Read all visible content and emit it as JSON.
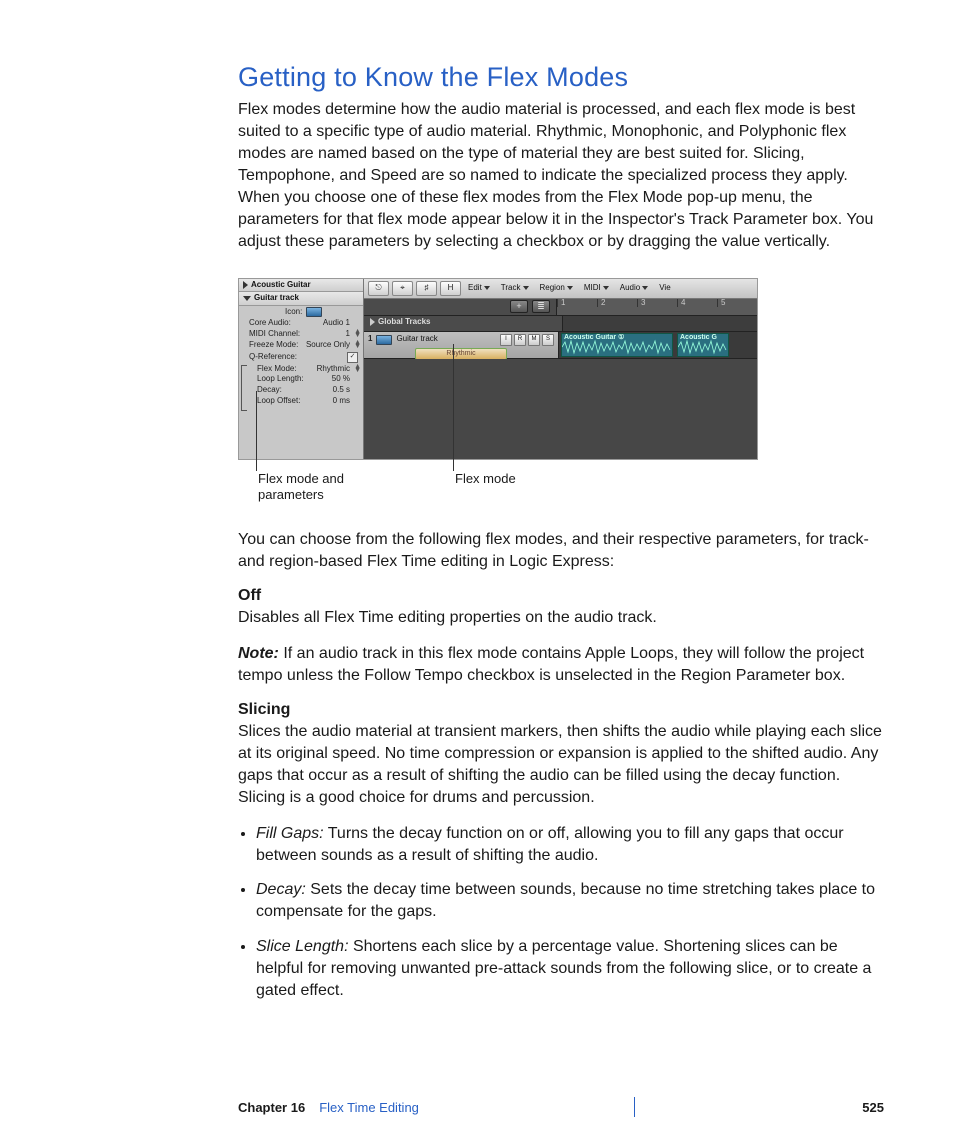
{
  "heading": "Getting to Know the Flex Modes",
  "intro": "Flex modes determine how the audio material is processed, and each flex mode is best suited to a specific type of audio material. Rhythmic, Monophonic, and Polyphonic flex modes are named based on the type of material they are best suited for. Slicing, Tempophone, and Speed are so named to indicate the specialized process they apply. When you choose one of these flex modes from the Flex Mode pop-up menu, the parameters for that flex mode appear below it in the Inspector's Track Parameter box. You adjust these parameters by selecting a checkbox or by dragging the value vertically.",
  "figure": {
    "inspector": {
      "header1": "Acoustic Guitar",
      "header2": "Guitar track",
      "rows": {
        "iconLabel": "Icon:",
        "coreAudio": {
          "label": "Core Audio:",
          "value": "Audio 1"
        },
        "midiChannel": {
          "label": "MIDI Channel:",
          "value": "1"
        },
        "freezeMode": {
          "label": "Freeze Mode:",
          "value": "Source Only"
        },
        "qref": {
          "label": "Q-Reference:",
          "checked": "✓"
        },
        "flexMode": {
          "label": "Flex Mode:",
          "value": "Rhythmic"
        },
        "loopLength": {
          "label": "Loop Length:",
          "value": "50 %"
        },
        "decay": {
          "label": "Decay:",
          "value": "0.5 s"
        },
        "loopOffset": {
          "label": "Loop Offset:",
          "value": "0 ms"
        }
      }
    },
    "arrange": {
      "toolbarButtons": [
        "⎋",
        "⌖",
        "♯",
        "H"
      ],
      "menus": [
        "Edit",
        "Track",
        "Region",
        "MIDI",
        "Audio",
        "Vie"
      ],
      "plus": "+",
      "listIcon": "≣",
      "rulerNums": [
        "1",
        "2",
        "3",
        "4",
        "5"
      ],
      "globalTracks": "Global Tracks",
      "trackNum": "1",
      "trackName": "Guitar track",
      "irm": [
        "I",
        "R",
        "M",
        "S"
      ],
      "flexPill": "Rhythmic",
      "region1": "Acoustic Guitar ①",
      "region2": "Acoustic G"
    },
    "callouts": {
      "left": "Flex mode and parameters",
      "leftLine2": "parameters",
      "leftLine1": "Flex mode and",
      "right": "Flex mode"
    }
  },
  "afterFigure": "You can choose from the following flex modes, and their respective parameters, for track- and region-based Flex Time editing in Logic Express:",
  "off": {
    "title": "Off",
    "body": "Disables all Flex Time editing properties on the audio track.",
    "noteLabel": "Note:",
    "note": " If an audio track in this flex mode contains Apple Loops, they will follow the project tempo unless the Follow Tempo checkbox is unselected in the Region Parameter box."
  },
  "slicing": {
    "title": "Slicing",
    "body": "Slices the audio material at transient markers, then shifts the audio while playing each slice at its original speed. No time compression or expansion is applied to the shifted audio. Any gaps that occur as a result of shifting the audio can be filled using the decay function. Slicing is a good choice for drums and percussion.",
    "bullets": [
      {
        "term": "Fill Gaps:",
        "text": "  Turns the decay function on or off, allowing you to fill any gaps that occur between sounds as a result of shifting the audio."
      },
      {
        "term": "Decay:",
        "text": "  Sets the decay time between sounds, because no time stretching takes place to compensate for the gaps."
      },
      {
        "term": "Slice Length:",
        "text": "  Shortens each slice by a percentage value. Shortening slices can be helpful for removing unwanted pre-attack sounds from the following slice, or to create a gated effect."
      }
    ]
  },
  "footer": {
    "chapter": "Chapter 16",
    "title": "Flex Time Editing",
    "page": "525"
  }
}
